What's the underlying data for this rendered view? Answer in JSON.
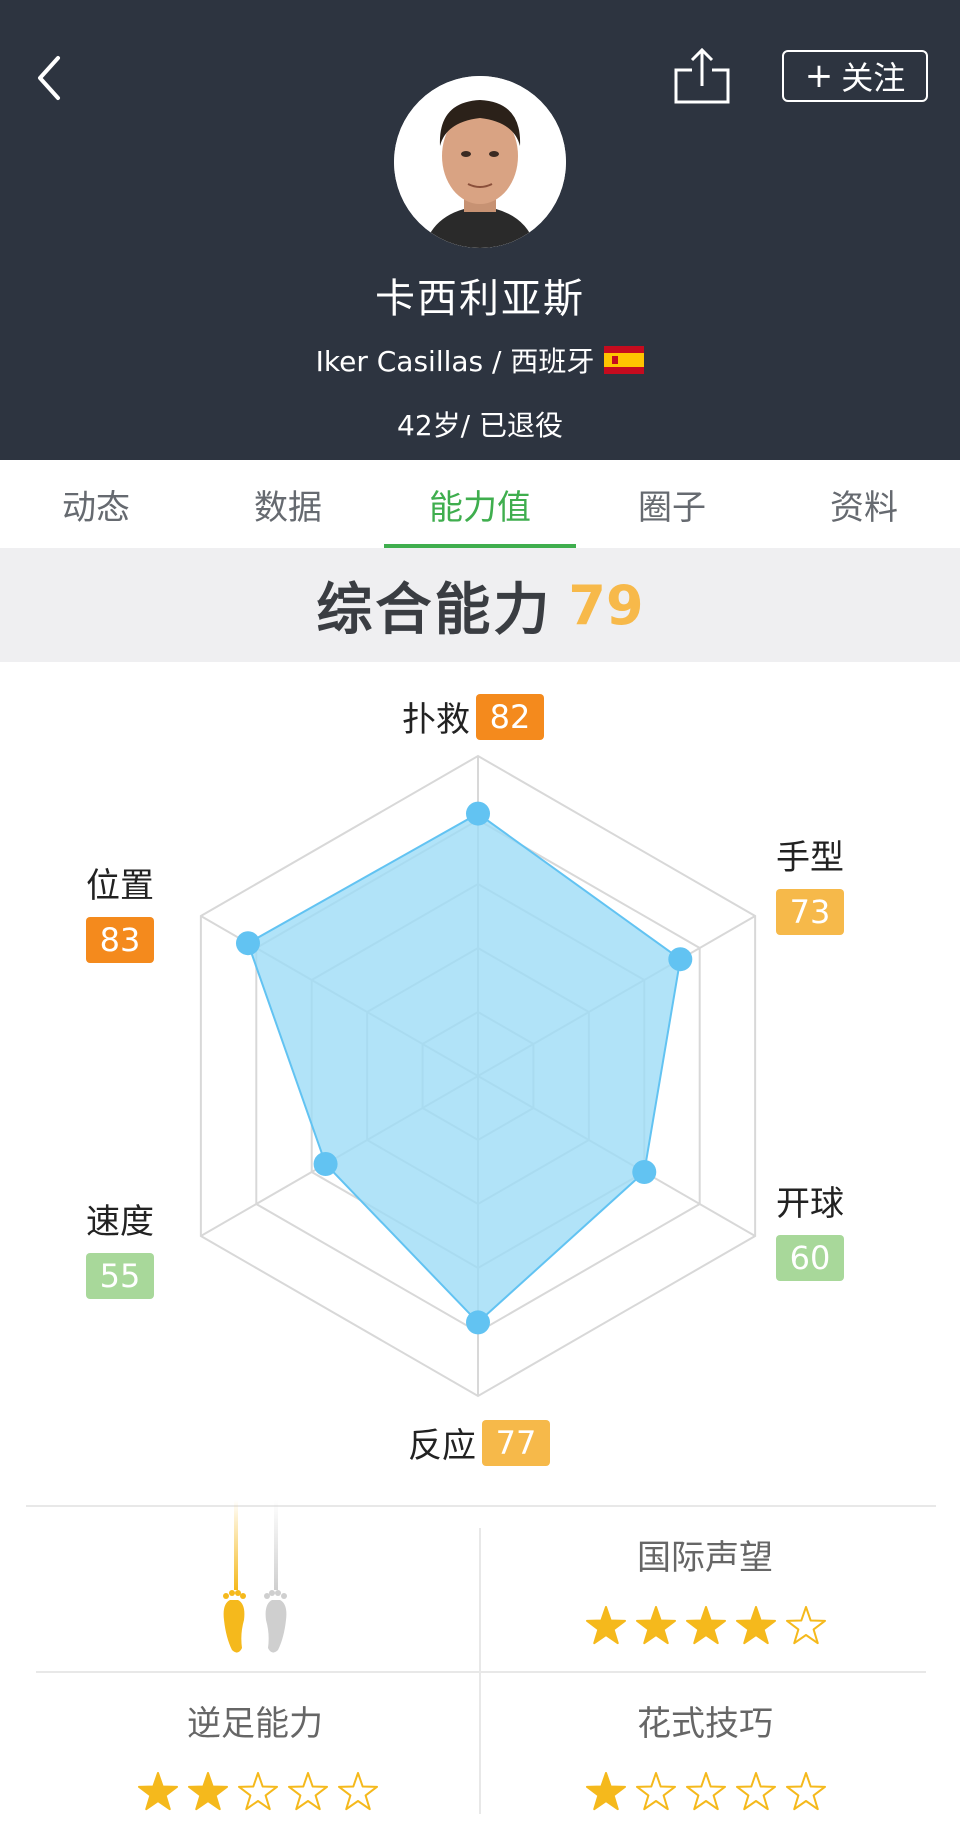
{
  "header": {
    "follow_label": "关注",
    "name": "卡西利亚斯",
    "subtitle": "Iker Casillas / 西班牙",
    "age_status": "42岁/ 已退役"
  },
  "tabs": [
    {
      "label": "动态"
    },
    {
      "label": "数据"
    },
    {
      "label": "能力值",
      "active": true
    },
    {
      "label": "圈子"
    },
    {
      "label": "资料"
    }
  ],
  "overall": {
    "title": "综合能力",
    "value": "79"
  },
  "attributes": [
    {
      "label": "扑救",
      "value": 82,
      "color": "#f48a1d"
    },
    {
      "label": "手型",
      "value": 73,
      "color": "#f6b94a"
    },
    {
      "label": "开球",
      "value": 60,
      "color": "#a8d89a"
    },
    {
      "label": "反应",
      "value": 77,
      "color": "#f6b94a"
    },
    {
      "label": "速度",
      "value": 55,
      "color": "#a8d89a"
    },
    {
      "label": "位置",
      "value": 83,
      "color": "#f48a1d"
    }
  ],
  "chart_data": {
    "type": "radar",
    "categories": [
      "扑救",
      "手型",
      "开球",
      "反应",
      "速度",
      "位置"
    ],
    "values": [
      82,
      73,
      60,
      77,
      55,
      83
    ],
    "max": 100,
    "fill_color": "#9ddcf6",
    "point_color": "#62c3f2"
  },
  "ratings": {
    "intl_reputation": {
      "title": "国际声望",
      "stars": 4,
      "max": 5
    },
    "weak_foot": {
      "title": "逆足能力",
      "stars": 2,
      "max": 5
    },
    "skill_moves": {
      "title": "花式技巧",
      "stars": 1,
      "max": 5
    }
  },
  "colors": {
    "header_bg": "#2d3440",
    "accent_green": "#3fae4e",
    "star_gold": "#f5b91c"
  },
  "icons": {
    "back": "chevron-left-icon",
    "share": "share-icon",
    "foot_left": "left-foot-icon",
    "foot_right": "right-foot-icon"
  }
}
